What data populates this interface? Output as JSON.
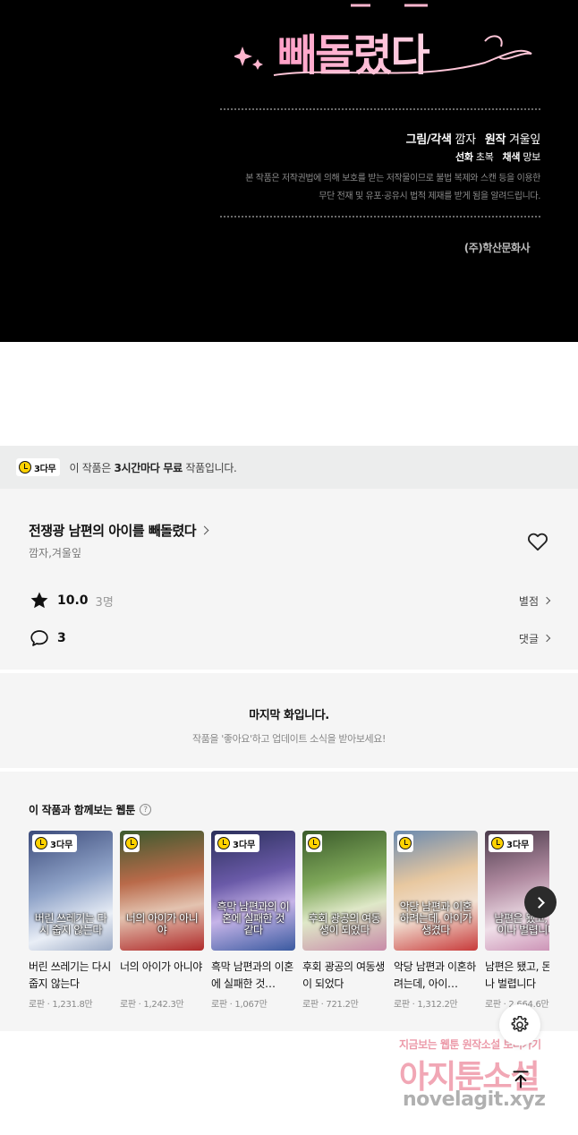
{
  "credits": {
    "title_art": "빼돌렸다",
    "art_label": "그림/각색",
    "art_value": "깜자",
    "original_label": "원작",
    "original_value": "겨울잎",
    "line_label": "선화",
    "line_value": "초복",
    "color_label": "채색",
    "color_value": "망보",
    "notice_line1": "본 작품은 저작권법에 의해 보호를 받는 저작물이므로 불법 복제와 스캔 등을 이용한",
    "notice_line2": "무단 전재 및 유포·공유시 법적 제재를 받게 됨을 알려드립니다.",
    "publisher": "(주)학산문화사"
  },
  "free_bar": {
    "badge": "3다무",
    "text_prefix": "이 작품은 ",
    "text_bold": "3시간마다 무료",
    "text_suffix": " 작품입니다."
  },
  "work": {
    "title": "전쟁광 남편의 아이를 빼돌렸다",
    "authors": "깜자,겨울잎",
    "rating": "10.0",
    "rating_count": "3명",
    "rating_link": "별점",
    "comments": "3",
    "comments_link": "댓글"
  },
  "last_episode": {
    "heading": "마지막 화입니다.",
    "subtext": "작품을 '좋아요'하고 업데이트 소식을 받아보세요!"
  },
  "recommendations": {
    "heading": "이 작품과 함께보는 웹툰",
    "help": "?",
    "items": [
      {
        "badge": "3다무",
        "cover_text": "버린 쓰레기는 다시 줍지 않는다",
        "name": "버린 쓰레기는 다시 줍지 않는다",
        "meta": "로판 · 1,231.8만"
      },
      {
        "badge": "",
        "cover_text": "너의 아이가 아니야",
        "name": "너의 아이가 아니야",
        "meta": "로판 · 1,242.3만"
      },
      {
        "badge": "3다무",
        "cover_text": "흑막 남편과의 이혼에 실패한 것 같다",
        "name": "흑막 남편과의 이혼에 실패한 것…",
        "meta": "로판 · 1,067만"
      },
      {
        "badge": "",
        "cover_text": "후회 광공의 여동생이 되었다",
        "name": "후회 광공의 여동생이 되었다",
        "meta": "로판 · 721.2만"
      },
      {
        "badge": "",
        "cover_text": "악당 남편과 이혼하려는데, 아이가 생겼다",
        "name": "악당 남편과 이혼하려는데, 아이…",
        "meta": "로판 · 1,312.2만"
      },
      {
        "badge": "3다무",
        "cover_text": "남편은 됐고, 돈이나 벌렵니다",
        "name": "남편은 됐고, 돈이나 벌렵니다",
        "meta": "로판 · 2,664.6만"
      }
    ]
  },
  "watermark": {
    "line1": "지금보는 웹툰 원작소설 보러가기",
    "line2": "아지툰소설",
    "line3": "novelagit.xyz"
  },
  "colors": {
    "badge_yellow": "#ffd200",
    "title_pink": "#f7a6c4",
    "panel_bg": "#f5f5f5"
  }
}
